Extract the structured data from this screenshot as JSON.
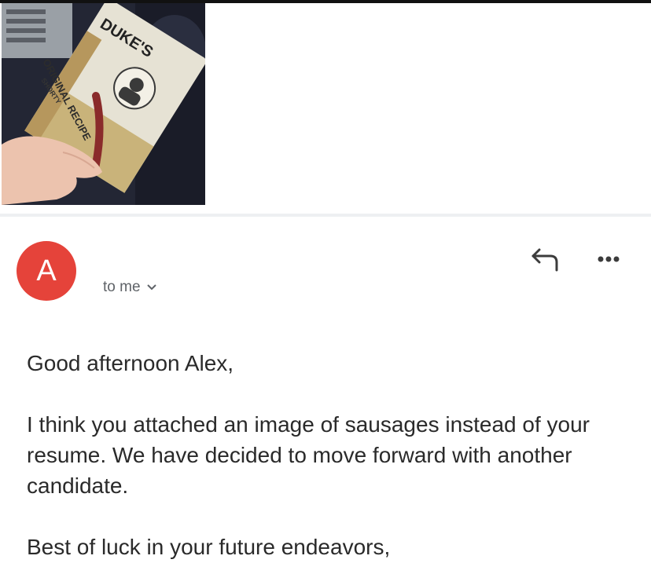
{
  "attachment": {
    "brand_text": "DUKE'S",
    "product_text": "ORIGINAL RECIPE",
    "subtitle_text": "SHORTY"
  },
  "sender": {
    "avatar_letter": "A",
    "avatar_color": "#e5433a"
  },
  "recipient": {
    "label": "to me"
  },
  "actions": {
    "reply_icon": "reply-icon",
    "more_icon": "more-options-icon"
  },
  "message": {
    "greeting": "Good afternoon Alex,",
    "body": "I think you attached an image of sausages instead of your resume. We have decided to move forward with another candidate.",
    "closing": "Best of luck in your future endeavors,"
  }
}
